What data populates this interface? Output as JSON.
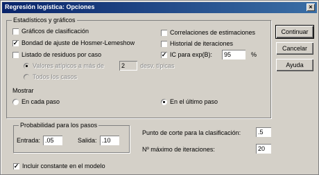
{
  "window": {
    "title": "Regresión logística: Opciones",
    "close": "×"
  },
  "stats_group": {
    "label": "Estadísticos y gráficos",
    "classification_plots": {
      "label": "Gráficos de clasificación",
      "checked": false
    },
    "hosmer": {
      "label": "Bondad de ajuste de Hosmer-Lemeshow",
      "checked": true
    },
    "casewise": {
      "label": "Listado de residuos por caso",
      "checked": false
    },
    "outliers": {
      "label": "Valores atípicos a más de",
      "value": "2",
      "suffix": "desv. típicas"
    },
    "all_cases": {
      "label": "Todos los casos"
    },
    "correlations": {
      "label": "Correlaciones de estimaciones",
      "checked": false
    },
    "iteration_history": {
      "label": "Historial de iteraciones",
      "checked": false
    },
    "ci_exp_b": {
      "label": "IC para exp(B):",
      "checked": true,
      "value": "95",
      "unit": "%"
    }
  },
  "display": {
    "label": "Mostrar",
    "each_step": {
      "label": "En cada paso",
      "selected": false
    },
    "last_step": {
      "label": "En el último paso",
      "selected": true
    }
  },
  "stepping_group": {
    "label": "Probabilidad para los pasos",
    "entry": {
      "label": "Entrada:",
      "value": ".05"
    },
    "removal": {
      "label": "Salida:",
      "value": ".10"
    }
  },
  "cutoff": {
    "label": "Punto de corte para la clasificación:",
    "value": ".5"
  },
  "max_iter": {
    "label": "Nº máximo de iteraciones:",
    "value": "20"
  },
  "include_constant": {
    "label": "Incluir constante en el modelo",
    "checked": true
  },
  "buttons": {
    "continue": "Continuar",
    "cancel": "Cancelar",
    "help": "Ayuda"
  }
}
